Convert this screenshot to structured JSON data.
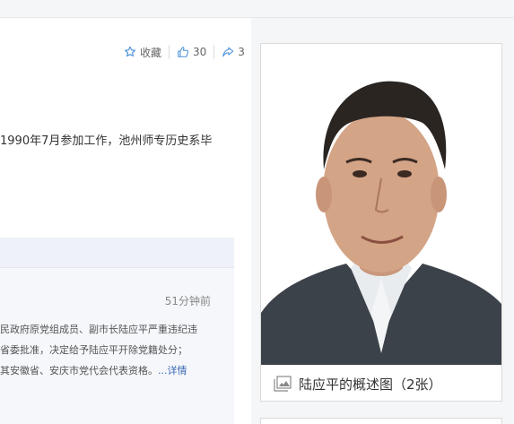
{
  "actions": {
    "favorite_label": "收藏",
    "like_count": "30",
    "share_count": "3"
  },
  "summary": {
    "text": "1990年7月参加工作，池州师专历史系毕"
  },
  "news": {
    "time": "51分钟前",
    "lines": [
      "民政府原党组成员、副市长陆应平严重违纪违",
      "省委批准，决定给予陆应平开除党籍处分；",
      "其安徽省、安庆市党代会代表资格。"
    ],
    "more_label": "...详情"
  },
  "album": {
    "caption": "陆应平的概述图（2张）"
  },
  "colors": {
    "accent_blue": "#3a68b5",
    "icon_blue": "#4a90d9"
  },
  "icons": {
    "favorite": "star-icon",
    "like": "thumbs-up-icon",
    "share": "share-arrow-icon",
    "album": "image-gallery-icon"
  }
}
